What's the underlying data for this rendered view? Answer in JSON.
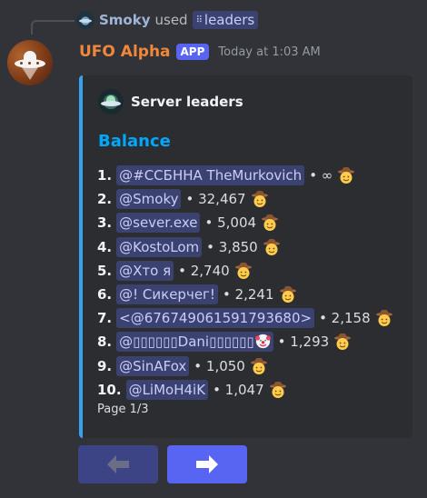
{
  "reply": {
    "user": "Smoky",
    "used_text": "used",
    "command": "leaders"
  },
  "message": {
    "bot_name": "UFO Alpha",
    "badge": "APP",
    "timestamp": "Today at 1:03 AM"
  },
  "embed": {
    "accent_color": "#3aa0f0",
    "author": "Server leaders",
    "title": "Balance",
    "rows": [
      {
        "rank": "1.",
        "mention": "@#ССБННА TheMurkovich",
        "score": "• ∞"
      },
      {
        "rank": "2.",
        "mention": "@Smoky",
        "score": "• 32,467"
      },
      {
        "rank": "3.",
        "mention": "@sever.exe",
        "score": "• 5,004"
      },
      {
        "rank": "4.",
        "mention": "@KostoLom",
        "score": "• 3,850"
      },
      {
        "rank": "5.",
        "mention": "@Хто я",
        "score": "• 2,740"
      },
      {
        "rank": "6.",
        "mention": "@! Сикерчег!",
        "score": "• 2,241"
      },
      {
        "rank": "7.",
        "mention": "<@676749061591793680>",
        "score": "• 2,158"
      },
      {
        "rank": "8.",
        "mention": "@▯▯▯▯▯▯Dani▯▯▯▯▯▯",
        "score": "• 1,293",
        "extra_icon": "clown-icon"
      },
      {
        "rank": "9.",
        "mention": "@SinAFox",
        "score": "• 1,050"
      },
      {
        "rank": "10.",
        "mention": "@LiMoH4iK",
        "score": "• 1,047"
      }
    ],
    "row_icon": "cowboy-emoji-icon",
    "footer": "Page 1/3"
  },
  "buttons": {
    "prev_icon": "arrow-left-icon",
    "next_icon": "arrow-right-icon"
  },
  "colors": {
    "background": "#313338",
    "embed_bg": "#2b2d31",
    "bot_name": "#f0873a",
    "mention_bg": "#3c4270",
    "button": "#5865f2"
  }
}
